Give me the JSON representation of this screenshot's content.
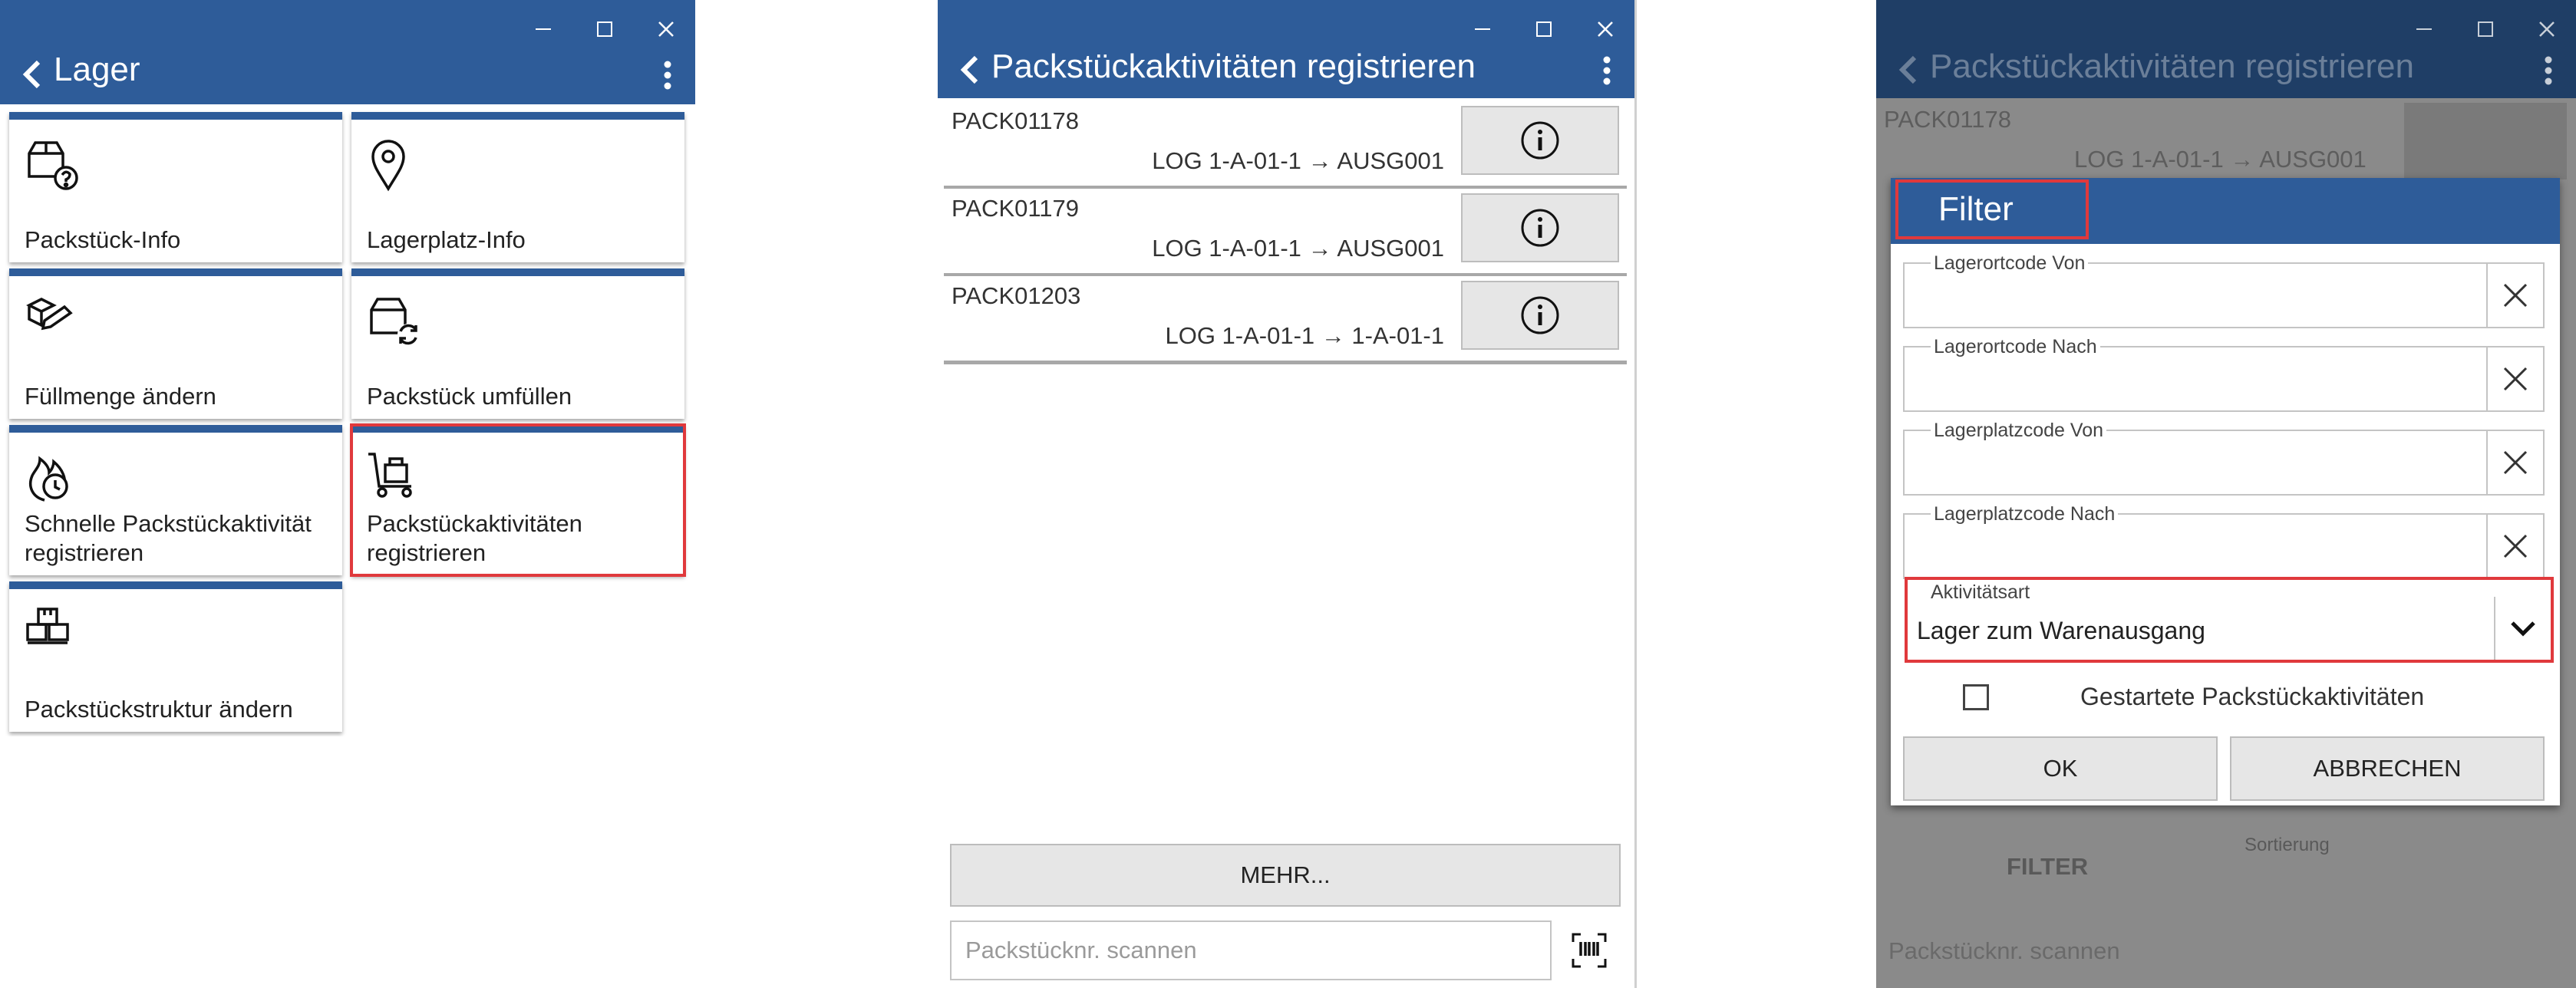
{
  "window1": {
    "title": "Lager",
    "tiles": [
      {
        "label": "Packstück-Info",
        "icon": "package-question-icon"
      },
      {
        "label": "Lagerplatz-Info",
        "icon": "location-pin-icon"
      },
      {
        "label": "Füllmenge ändern",
        "icon": "boxes-edit-icon"
      },
      {
        "label": "Packstück umfüllen",
        "icon": "package-refresh-icon"
      },
      {
        "label": "Schnelle Packstückaktivität registrieren",
        "icon": "fire-clock-icon"
      },
      {
        "label": "Packstückaktivitäten registrieren",
        "icon": "hand-truck-icon"
      },
      {
        "label": "Packstückstruktur ändern",
        "icon": "package-structure-icon"
      }
    ]
  },
  "window2": {
    "title": "Packstückaktivitäten registrieren",
    "rows": [
      {
        "code": "PACK01178",
        "route": "LOG 1-A-01-1 → AUSG001"
      },
      {
        "code": "PACK01179",
        "route": "LOG 1-A-01-1 → AUSG001"
      },
      {
        "code": "PACK01203",
        "route": "LOG 1-A-01-1 → 1-A-01-1"
      }
    ],
    "more_label": "MEHR...",
    "scan_placeholder": "Packstücknr. scannen"
  },
  "window3": {
    "title": "Packstückaktivitäten registrieren",
    "bg_code": "PACK01178",
    "bg_route": "LOG 1-A-01-1 → AUSG001",
    "bg_filter_label": "FILTER",
    "bg_sort_label": "Sortierung",
    "bg_scan_placeholder": "Packstücknr. scannen",
    "dialog": {
      "title": "Filter",
      "fields": [
        {
          "label": "Lagerortcode Von",
          "value": ""
        },
        {
          "label": "Lagerortcode Nach",
          "value": ""
        },
        {
          "label": "Lagerplatzcode Von",
          "value": ""
        },
        {
          "label": "Lagerplatzcode Nach",
          "value": ""
        }
      ],
      "activity_label": "Aktivitätsart",
      "activity_value": "Lager zum Warenausgang",
      "checkbox_label": "Gestartete Packstückaktivitäten",
      "checkbox_checked": false,
      "ok_label": "OK",
      "cancel_label": "ABBRECHEN"
    }
  },
  "colors": {
    "header": "#2e5c99",
    "highlight": "#e0393c",
    "button": "#e6e6e6"
  }
}
